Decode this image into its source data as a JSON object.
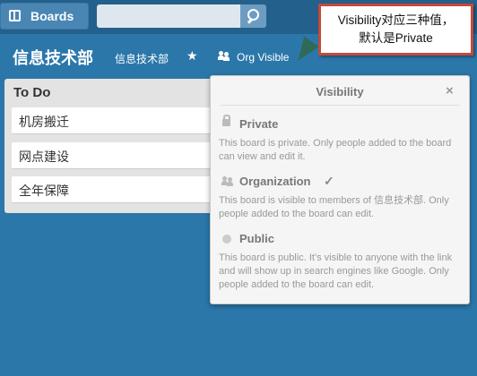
{
  "header": {
    "boards_label": "Boards",
    "search_value": ""
  },
  "board": {
    "title": "信息技术部",
    "org_name": "信息技术部",
    "visibility_label": "Org Visible"
  },
  "annotation": {
    "line1": "Visibility对应三种值，",
    "line2": "默认是Private"
  },
  "list": {
    "title": "To Do",
    "cards": [
      "机房搬迁",
      "网点建设",
      "全年保障"
    ]
  },
  "popover": {
    "title": "Visibility",
    "close": "×",
    "options": [
      {
        "name": "Private",
        "description": "This board is private. Only people added to the board can view and edit it.",
        "icon": "lock-icon",
        "selected": false
      },
      {
        "name": "Organization",
        "description": "This board is visible to members of 信息技术部. Only people added to the board can edit.",
        "icon": "people-icon",
        "selected": true
      },
      {
        "name": "Public",
        "description": "This board is public. It's visible to anyone with the link and will show up in search engines like Google. Only people added to the board can edit.",
        "icon": "globe-icon",
        "selected": false
      }
    ]
  },
  "colors": {
    "background": "#2b77aa",
    "topbar": "#24608c",
    "callout_border": "#c44a3c"
  }
}
